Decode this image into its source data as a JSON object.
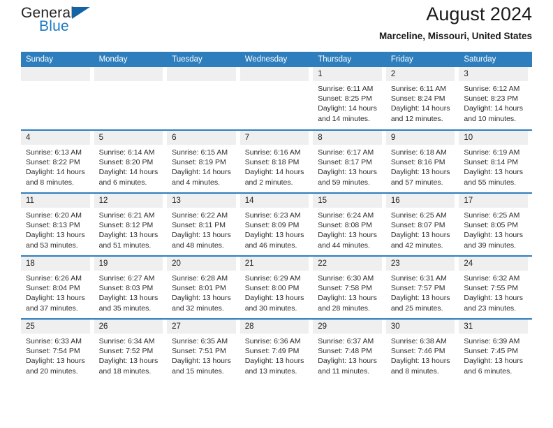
{
  "brand": {
    "line1": "General",
    "line2": "Blue",
    "accent_color": "#1464a5"
  },
  "header": {
    "title": "August 2024",
    "location": "Marceline, Missouri, United States",
    "header_bg_color": "#2e7ebd"
  },
  "weekday_headers": [
    "Sunday",
    "Monday",
    "Tuesday",
    "Wednesday",
    "Thursday",
    "Friday",
    "Saturday"
  ],
  "labels": {
    "sunrise": "Sunrise:",
    "sunset": "Sunset:",
    "daylight": "Daylight:"
  },
  "weeks": [
    [
      {
        "day": "",
        "empty": true
      },
      {
        "day": "",
        "empty": true
      },
      {
        "day": "",
        "empty": true
      },
      {
        "day": "",
        "empty": true
      },
      {
        "day": "1",
        "sunrise": "Sunrise: 6:11 AM",
        "sunset": "Sunset: 8:25 PM",
        "daylight1": "Daylight: 14 hours",
        "daylight2": "and 14 minutes."
      },
      {
        "day": "2",
        "sunrise": "Sunrise: 6:11 AM",
        "sunset": "Sunset: 8:24 PM",
        "daylight1": "Daylight: 14 hours",
        "daylight2": "and 12 minutes."
      },
      {
        "day": "3",
        "sunrise": "Sunrise: 6:12 AM",
        "sunset": "Sunset: 8:23 PM",
        "daylight1": "Daylight: 14 hours",
        "daylight2": "and 10 minutes."
      }
    ],
    [
      {
        "day": "4",
        "sunrise": "Sunrise: 6:13 AM",
        "sunset": "Sunset: 8:22 PM",
        "daylight1": "Daylight: 14 hours",
        "daylight2": "and 8 minutes."
      },
      {
        "day": "5",
        "sunrise": "Sunrise: 6:14 AM",
        "sunset": "Sunset: 8:20 PM",
        "daylight1": "Daylight: 14 hours",
        "daylight2": "and 6 minutes."
      },
      {
        "day": "6",
        "sunrise": "Sunrise: 6:15 AM",
        "sunset": "Sunset: 8:19 PM",
        "daylight1": "Daylight: 14 hours",
        "daylight2": "and 4 minutes."
      },
      {
        "day": "7",
        "sunrise": "Sunrise: 6:16 AM",
        "sunset": "Sunset: 8:18 PM",
        "daylight1": "Daylight: 14 hours",
        "daylight2": "and 2 minutes."
      },
      {
        "day": "8",
        "sunrise": "Sunrise: 6:17 AM",
        "sunset": "Sunset: 8:17 PM",
        "daylight1": "Daylight: 13 hours",
        "daylight2": "and 59 minutes."
      },
      {
        "day": "9",
        "sunrise": "Sunrise: 6:18 AM",
        "sunset": "Sunset: 8:16 PM",
        "daylight1": "Daylight: 13 hours",
        "daylight2": "and 57 minutes."
      },
      {
        "day": "10",
        "sunrise": "Sunrise: 6:19 AM",
        "sunset": "Sunset: 8:14 PM",
        "daylight1": "Daylight: 13 hours",
        "daylight2": "and 55 minutes."
      }
    ],
    [
      {
        "day": "11",
        "sunrise": "Sunrise: 6:20 AM",
        "sunset": "Sunset: 8:13 PM",
        "daylight1": "Daylight: 13 hours",
        "daylight2": "and 53 minutes."
      },
      {
        "day": "12",
        "sunrise": "Sunrise: 6:21 AM",
        "sunset": "Sunset: 8:12 PM",
        "daylight1": "Daylight: 13 hours",
        "daylight2": "and 51 minutes."
      },
      {
        "day": "13",
        "sunrise": "Sunrise: 6:22 AM",
        "sunset": "Sunset: 8:11 PM",
        "daylight1": "Daylight: 13 hours",
        "daylight2": "and 48 minutes."
      },
      {
        "day": "14",
        "sunrise": "Sunrise: 6:23 AM",
        "sunset": "Sunset: 8:09 PM",
        "daylight1": "Daylight: 13 hours",
        "daylight2": "and 46 minutes."
      },
      {
        "day": "15",
        "sunrise": "Sunrise: 6:24 AM",
        "sunset": "Sunset: 8:08 PM",
        "daylight1": "Daylight: 13 hours",
        "daylight2": "and 44 minutes."
      },
      {
        "day": "16",
        "sunrise": "Sunrise: 6:25 AM",
        "sunset": "Sunset: 8:07 PM",
        "daylight1": "Daylight: 13 hours",
        "daylight2": "and 42 minutes."
      },
      {
        "day": "17",
        "sunrise": "Sunrise: 6:25 AM",
        "sunset": "Sunset: 8:05 PM",
        "daylight1": "Daylight: 13 hours",
        "daylight2": "and 39 minutes."
      }
    ],
    [
      {
        "day": "18",
        "sunrise": "Sunrise: 6:26 AM",
        "sunset": "Sunset: 8:04 PM",
        "daylight1": "Daylight: 13 hours",
        "daylight2": "and 37 minutes."
      },
      {
        "day": "19",
        "sunrise": "Sunrise: 6:27 AM",
        "sunset": "Sunset: 8:03 PM",
        "daylight1": "Daylight: 13 hours",
        "daylight2": "and 35 minutes."
      },
      {
        "day": "20",
        "sunrise": "Sunrise: 6:28 AM",
        "sunset": "Sunset: 8:01 PM",
        "daylight1": "Daylight: 13 hours",
        "daylight2": "and 32 minutes."
      },
      {
        "day": "21",
        "sunrise": "Sunrise: 6:29 AM",
        "sunset": "Sunset: 8:00 PM",
        "daylight1": "Daylight: 13 hours",
        "daylight2": "and 30 minutes."
      },
      {
        "day": "22",
        "sunrise": "Sunrise: 6:30 AM",
        "sunset": "Sunset: 7:58 PM",
        "daylight1": "Daylight: 13 hours",
        "daylight2": "and 28 minutes."
      },
      {
        "day": "23",
        "sunrise": "Sunrise: 6:31 AM",
        "sunset": "Sunset: 7:57 PM",
        "daylight1": "Daylight: 13 hours",
        "daylight2": "and 25 minutes."
      },
      {
        "day": "24",
        "sunrise": "Sunrise: 6:32 AM",
        "sunset": "Sunset: 7:55 PM",
        "daylight1": "Daylight: 13 hours",
        "daylight2": "and 23 minutes."
      }
    ],
    [
      {
        "day": "25",
        "sunrise": "Sunrise: 6:33 AM",
        "sunset": "Sunset: 7:54 PM",
        "daylight1": "Daylight: 13 hours",
        "daylight2": "and 20 minutes."
      },
      {
        "day": "26",
        "sunrise": "Sunrise: 6:34 AM",
        "sunset": "Sunset: 7:52 PM",
        "daylight1": "Daylight: 13 hours",
        "daylight2": "and 18 minutes."
      },
      {
        "day": "27",
        "sunrise": "Sunrise: 6:35 AM",
        "sunset": "Sunset: 7:51 PM",
        "daylight1": "Daylight: 13 hours",
        "daylight2": "and 15 minutes."
      },
      {
        "day": "28",
        "sunrise": "Sunrise: 6:36 AM",
        "sunset": "Sunset: 7:49 PM",
        "daylight1": "Daylight: 13 hours",
        "daylight2": "and 13 minutes."
      },
      {
        "day": "29",
        "sunrise": "Sunrise: 6:37 AM",
        "sunset": "Sunset: 7:48 PM",
        "daylight1": "Daylight: 13 hours",
        "daylight2": "and 11 minutes."
      },
      {
        "day": "30",
        "sunrise": "Sunrise: 6:38 AM",
        "sunset": "Sunset: 7:46 PM",
        "daylight1": "Daylight: 13 hours",
        "daylight2": "and 8 minutes."
      },
      {
        "day": "31",
        "sunrise": "Sunrise: 6:39 AM",
        "sunset": "Sunset: 7:45 PM",
        "daylight1": "Daylight: 13 hours",
        "daylight2": "and 6 minutes."
      }
    ]
  ]
}
